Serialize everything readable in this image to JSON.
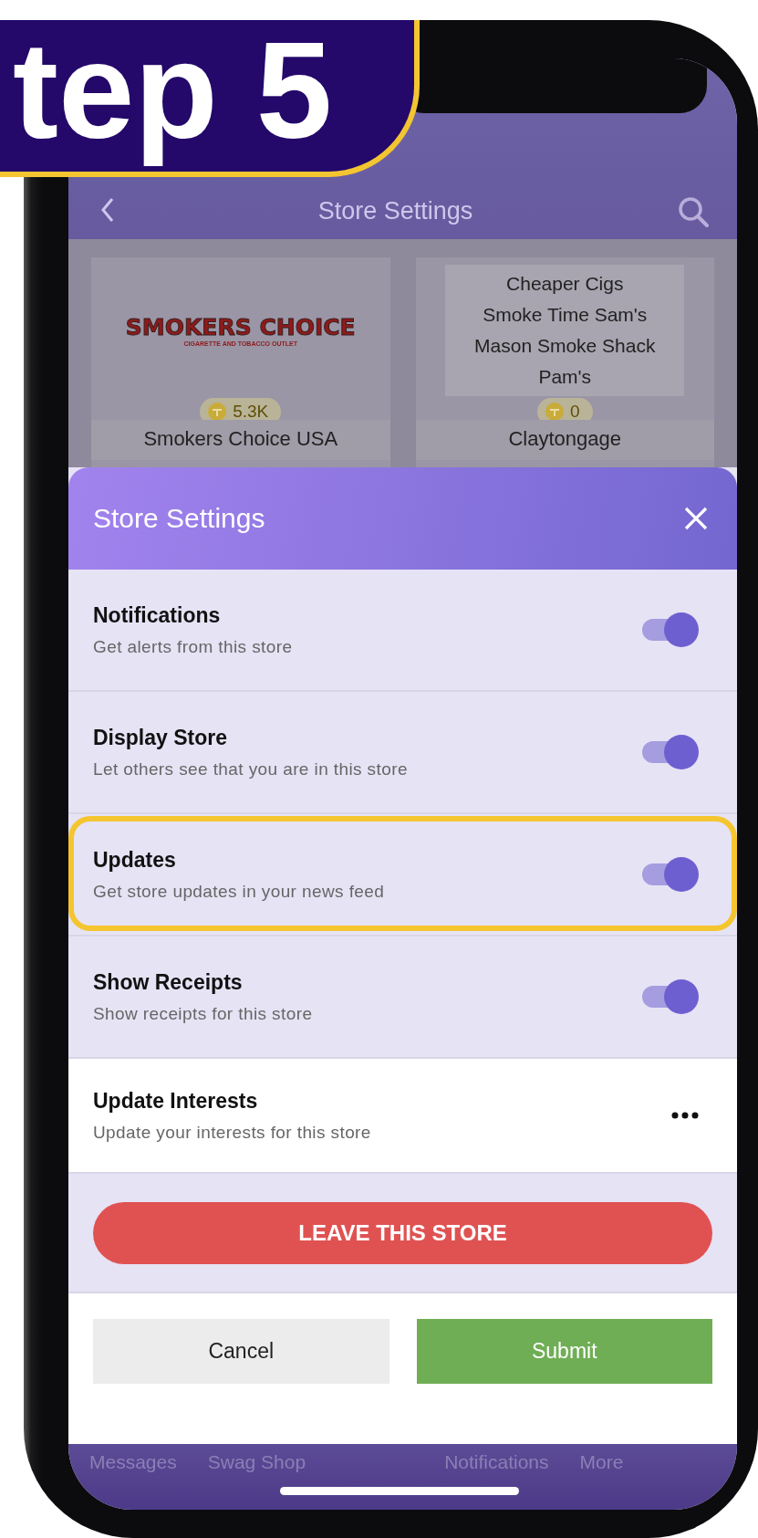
{
  "banner": {
    "text": "tep 5"
  },
  "header": {
    "title": "Store Settings"
  },
  "stores": [
    {
      "kind": "logo",
      "logo_title": "SMOKERS CHOICE",
      "logo_subtitle": "CIGARETTE AND TOBACCO OUTLET",
      "count": "5.3K",
      "name": "Smokers Choice USA"
    },
    {
      "kind": "list",
      "lines": [
        "Cheaper Cigs",
        "Smoke Time Sam's",
        "Mason Smoke Shack",
        "Pam's"
      ],
      "count": "0",
      "name": "Claytongage"
    }
  ],
  "sheet": {
    "title": "Store Settings",
    "rows": [
      {
        "kind": "toggle",
        "title": "Notifications",
        "subtitle": "Get alerts from this store",
        "on": true,
        "highlighted": false
      },
      {
        "kind": "toggle",
        "title": "Display Store",
        "subtitle": "Let others see that you are in this store",
        "on": true,
        "highlighted": false
      },
      {
        "kind": "toggle",
        "title": "Updates",
        "subtitle": "Get store updates in your news feed",
        "on": true,
        "highlighted": true
      },
      {
        "kind": "toggle",
        "title": "Show Receipts",
        "subtitle": "Show receipts for this store",
        "on": true,
        "highlighted": false
      },
      {
        "kind": "more",
        "title": "Update Interests",
        "subtitle": "Update your interests for this store",
        "highlighted": false
      }
    ],
    "leave_button": "LEAVE THIS STORE",
    "cancel_button": "Cancel",
    "submit_button": "Submit"
  },
  "tab_bar": [
    "Messages",
    "Swag Shop",
    "Notifications",
    "More"
  ]
}
